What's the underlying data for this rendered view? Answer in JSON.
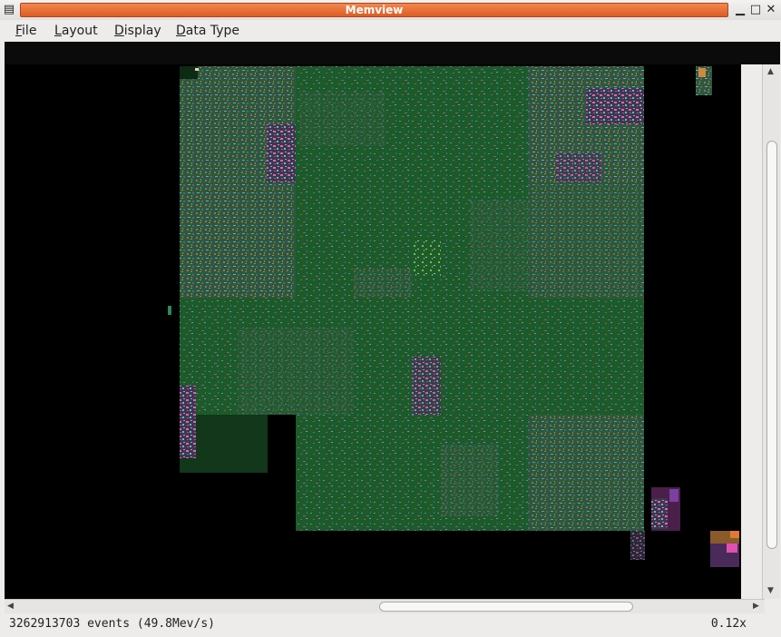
{
  "window": {
    "title": "Memview"
  },
  "menu": [
    {
      "underline": "F",
      "rest": "ile"
    },
    {
      "underline": "L",
      "rest": "ayout"
    },
    {
      "underline": "D",
      "rest": "isplay"
    },
    {
      "underline": "D",
      "rest": "ata Type"
    }
  ],
  "status": {
    "events": "3262913703 events (49.8Mev/s)",
    "zoom": "0.12x"
  },
  "colors": {
    "base_green": "#1d5a2a",
    "dark_green": "#12371a",
    "title_orange": "#e8733a"
  }
}
